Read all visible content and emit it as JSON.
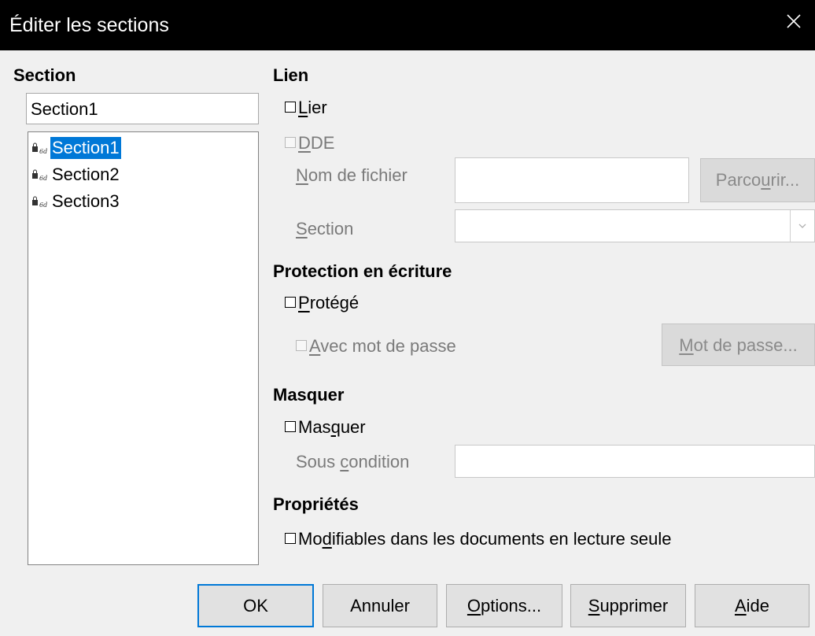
{
  "window": {
    "title": "Éditer les sections"
  },
  "left": {
    "header": "Section",
    "name_value": "Section1",
    "tree_items": [
      {
        "label": "Section1",
        "selected": true
      },
      {
        "label": "Section2",
        "selected": false
      },
      {
        "label": "Section3",
        "selected": false
      }
    ]
  },
  "link": {
    "header": "Lien",
    "lier_pre": "",
    "lier_ul": "L",
    "lier_post": "ier",
    "dde_pre": "",
    "dde_ul": "D",
    "dde_post": "DE",
    "filename_pre": "",
    "filename_ul": "N",
    "filename_post": "om de fichier",
    "filename_value": "",
    "browse_pre": "Parco",
    "browse_ul": "u",
    "browse_post": "rir...",
    "section_pre": "",
    "section_ul": "S",
    "section_post": "ection",
    "section_value": ""
  },
  "protection": {
    "header": "Protection en écriture",
    "protect_pre": "",
    "protect_ul": "P",
    "protect_post": "rotégé",
    "pwd_pre": "",
    "pwd_ul": "A",
    "pwd_post": "vec mot de passe",
    "pwd_btn_pre": "",
    "pwd_btn_ul": "M",
    "pwd_btn_post": "ot de passe..."
  },
  "hide": {
    "header": "Masquer",
    "hide_pre": "Mas",
    "hide_ul": "q",
    "hide_post": "uer",
    "cond_pre": "Sous ",
    "cond_ul": "c",
    "cond_post": "ondition",
    "cond_value": ""
  },
  "properties": {
    "header": "Propriétés",
    "editable_pre": "Mo",
    "editable_ul": "d",
    "editable_post": "ifiables dans les documents en lecture seule"
  },
  "buttons": {
    "ok": "OK",
    "cancel": "Annuler",
    "options_pre": "",
    "options_ul": "O",
    "options_post": "ptions...",
    "delete_pre": "",
    "delete_ul": "S",
    "delete_post": "upprimer",
    "help_pre": "",
    "help_ul": "A",
    "help_post": "ide"
  }
}
